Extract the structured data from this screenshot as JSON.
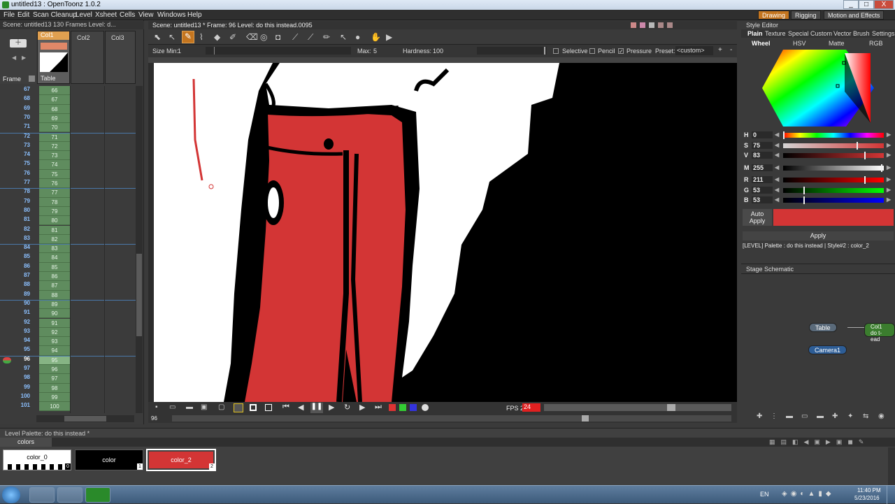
{
  "window": {
    "title": "untitled13 : OpenToonz 1.0.2",
    "min": "_",
    "max": "□",
    "close": "X"
  },
  "menu": [
    "File",
    "Edit",
    "Scan Cleanup",
    "Level",
    "Xsheet",
    "Cells",
    "View",
    "Windows",
    "Help"
  ],
  "rooms": [
    "Drawing",
    "Rigging",
    "Motion and Effects"
  ],
  "xsheet": {
    "info": "Scene: untitled13    130 Frames  Level: d...",
    "columns": [
      "Col1",
      "Col2",
      "Col3"
    ],
    "table_label": "Table",
    "frame_label": "Frame",
    "rows": [
      {
        "f": "67",
        "c": "66"
      },
      {
        "f": "68",
        "c": "67"
      },
      {
        "f": "69",
        "c": "68"
      },
      {
        "f": "70",
        "c": "69"
      },
      {
        "f": "71",
        "c": "70"
      },
      {
        "f": "72",
        "c": "71"
      },
      {
        "f": "73",
        "c": "72"
      },
      {
        "f": "74",
        "c": "73"
      },
      {
        "f": "75",
        "c": "74"
      },
      {
        "f": "76",
        "c": "75"
      },
      {
        "f": "77",
        "c": "76"
      },
      {
        "f": "78",
        "c": "77"
      },
      {
        "f": "79",
        "c": "78"
      },
      {
        "f": "80",
        "c": "79"
      },
      {
        "f": "81",
        "c": "80"
      },
      {
        "f": "82",
        "c": "81"
      },
      {
        "f": "83",
        "c": "82"
      },
      {
        "f": "84",
        "c": "83"
      },
      {
        "f": "85",
        "c": "84"
      },
      {
        "f": "86",
        "c": "85"
      },
      {
        "f": "87",
        "c": "86"
      },
      {
        "f": "88",
        "c": "87"
      },
      {
        "f": "89",
        "c": "88"
      },
      {
        "f": "90",
        "c": "89"
      },
      {
        "f": "91",
        "c": "90"
      },
      {
        "f": "92",
        "c": "91"
      },
      {
        "f": "93",
        "c": "92"
      },
      {
        "f": "94",
        "c": "93"
      },
      {
        "f": "95",
        "c": "94"
      },
      {
        "f": "96",
        "c": "95"
      },
      {
        "f": "97",
        "c": "96"
      },
      {
        "f": "98",
        "c": "97"
      },
      {
        "f": "99",
        "c": "98"
      },
      {
        "f": "100",
        "c": "99"
      },
      {
        "f": "101",
        "c": "100"
      }
    ],
    "current_frame": "96"
  },
  "viewer": {
    "info": "Scene: untitled13 *    Frame: 96    Level: do this instead.0095",
    "options": {
      "size_min_label": "Size Min:",
      "size_min": "1",
      "max_label": "Max:",
      "max": "5",
      "hardness_label": "Hardness:",
      "hardness": "100",
      "selective": "Selective",
      "pencil": "Pencil",
      "pressure": "Pressure",
      "preset_label": "Preset:",
      "preset": "<custom>"
    },
    "frame_field": "96",
    "fps_label": "FPS 2/",
    "fps": "24"
  },
  "style_editor": {
    "title": "Style Editor",
    "tabs": [
      "Plain",
      "Texture",
      "Special",
      "Custom",
      "Vector Brush",
      "Settings"
    ],
    "subtabs": [
      "Wheel",
      "HSV",
      "Matte",
      "RGB"
    ],
    "channels": [
      {
        "label": "H",
        "value": "0"
      },
      {
        "label": "S",
        "value": "75"
      },
      {
        "label": "V",
        "value": "83"
      },
      {
        "label": "M",
        "value": "255"
      },
      {
        "label": "R",
        "value": "211"
      },
      {
        "label": "G",
        "value": "53"
      },
      {
        "label": "B",
        "value": "53"
      }
    ],
    "auto_apply": "Auto Apply",
    "apply": "Apply",
    "status": "[LEVEL]   Palette : do this instead | Style#2 : color_2",
    "current_color": "#d33535"
  },
  "stage": {
    "title": "Stage Schematic",
    "nodes": [
      "Table",
      "Col1",
      "do t-ead",
      "Camera1"
    ]
  },
  "palette": {
    "title": "Level Palette: do this instead *",
    "tab": "colors",
    "styles": [
      {
        "name": "color_0",
        "idx": "0"
      },
      {
        "name": "color",
        "idx": "1"
      },
      {
        "name": "color_2",
        "idx": "2"
      }
    ]
  },
  "taskbar": {
    "lang": "EN",
    "time": "11:40 PM",
    "date": "5/23/2016"
  }
}
